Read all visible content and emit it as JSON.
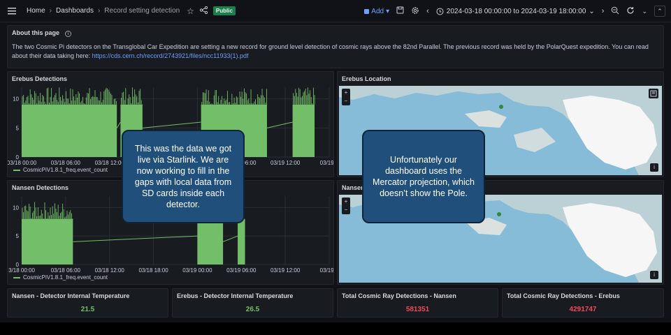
{
  "topbar": {
    "breadcrumbs": [
      "Home",
      "Dashboards",
      "Record setting detection"
    ],
    "badge": "Public",
    "add_label": "Add",
    "time_range": "2024-03-18 00:00:00 to 2024-03-19 18:00:00"
  },
  "about": {
    "title": "About this page",
    "text": "The two Cosmic Pi detectors on the Transglobal Car Expedition are setting a new record for ground level detection of cosmic rays above the 82nd Parallel. The previous record was held by the PolarQuest expedition. You can read about their data taking here: ",
    "link": "https://cds.cern.ch/record/2743921/files/ncc11933(1).pdf"
  },
  "erebus_detections": {
    "title": "Erebus Detections",
    "legend": "CosmicPiV1.8.1_freq.event_count",
    "y_ticks": [
      "10",
      "5",
      "0"
    ],
    "x_ticks": [
      "03/18 00:00",
      "03/18 06:00",
      "03/18 12:00",
      "03/18 18:00",
      "03/19 00:00",
      "03/19 06:00",
      "03/19 12:00",
      "03/19 1"
    ]
  },
  "nansen_detections": {
    "title": "Nansen Detections",
    "legend": "CosmicPiV1.8.1_freq.event_count",
    "y_ticks": [
      "10",
      "5",
      "0"
    ],
    "x_ticks": [
      "3/18 00:00",
      "03/18 06:00",
      "03/18 12:00",
      "03/18 18:00",
      "03/19 00:00",
      "03/19 06:00",
      "03/19 12:00",
      "03/19 1"
    ]
  },
  "erebus_location": {
    "title": "Erebus Location",
    "zoom_in": "+",
    "zoom_out": "−",
    "info": "i"
  },
  "nansen_location": {
    "title": "Nansen",
    "zoom_in": "+",
    "zoom_out": "−",
    "info": "i"
  },
  "stats": [
    {
      "title": "Nansen - Detector Internal Temperature",
      "value": "21.5",
      "color": "#73bf69"
    },
    {
      "title": "Erebus - Detector Internal Temperature",
      "value": "26.5",
      "color": "#73bf69"
    },
    {
      "title": "Total Cosmic Ray Detections - Nansen",
      "value": "581351",
      "color": "#f2495c"
    },
    {
      "title": "Total Cosmic Ray Detections - Erebus",
      "value": "4291747",
      "color": "#f2495c"
    }
  ],
  "callouts": {
    "left": "This was the data we got live via Starlink. We are now working to fill in the gaps with local data from SD cards inside each detector.",
    "right": "Unfortunately our dashboard uses the Mercator projection, which doesn’t show the Pole."
  },
  "colors": {
    "series": "#73bf69",
    "accent": "#6e9fff",
    "callout": "#1f4f7a"
  },
  "chart_data": [
    {
      "type": "bar",
      "title": "Erebus Detections",
      "x_range": [
        "2024-03-18 00:00",
        "2024-03-19 18:00"
      ],
      "ylim": [
        0,
        12
      ],
      "series": [
        {
          "name": "CosmicPiV1.8.1_freq.event_count",
          "segments": [
            {
              "start": "03/18 00:00",
              "end": "03/18 13:00",
              "typical": 9
            },
            {
              "start": "03/18 13:30",
              "end": "03/18 16:30",
              "typical": 9
            },
            {
              "start": "03/19 00:30",
              "end": "03/19 09:30",
              "typical": 9
            },
            {
              "start": "03/19 13:00",
              "end": "03/19 16:00",
              "typical": 9
            }
          ]
        }
      ]
    },
    {
      "type": "bar",
      "title": "Nansen Detections",
      "x_range": [
        "2024-03-18 00:00",
        "2024-03-19 18:00"
      ],
      "ylim": [
        0,
        12
      ],
      "series": [
        {
          "name": "CosmicPiV1.8.1_freq.event_count",
          "segments": [
            {
              "start": "03/18 00:00",
              "end": "03/18 07:00",
              "typical": 8
            },
            {
              "start": "03/19 00:00",
              "end": "03/19 03:30",
              "typical": 8
            },
            {
              "start": "03/19 05:30",
              "end": "03/19 06:30",
              "typical": 8
            }
          ]
        }
      ]
    }
  ]
}
